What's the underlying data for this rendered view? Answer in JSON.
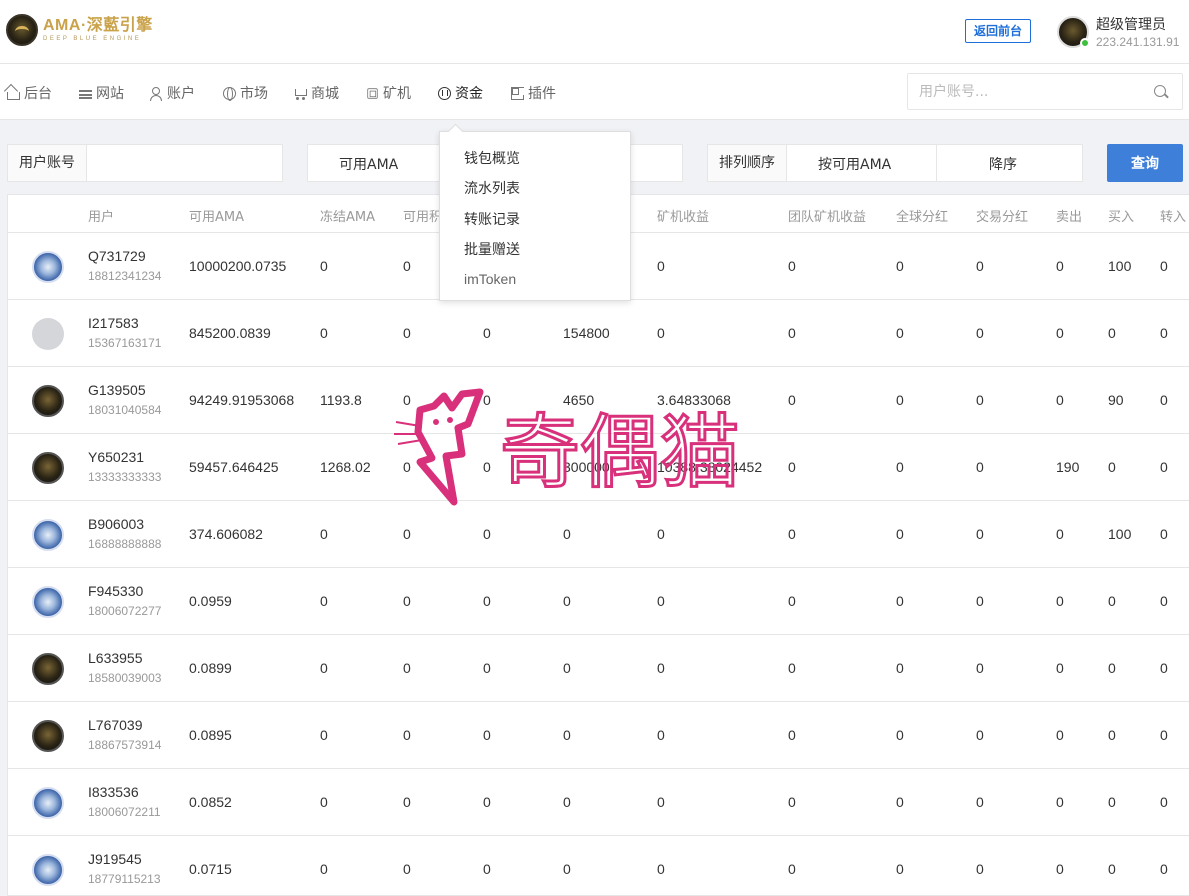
{
  "header": {
    "logo_main": "AMA·深藍引擎",
    "logo_sub": "DEEP BLUE ENGINE",
    "front_button": "返回前台",
    "admin_name": "超级管理员",
    "admin_ip": "223.241.131.91"
  },
  "nav": {
    "items": [
      {
        "label": "后台",
        "icon": "home-icon"
      },
      {
        "label": "网站",
        "icon": "list-icon"
      },
      {
        "label": "账户",
        "icon": "users-icon"
      },
      {
        "label": "市场",
        "icon": "globe-icon"
      },
      {
        "label": "商城",
        "icon": "cart-icon"
      },
      {
        "label": "矿机",
        "icon": "chip-icon"
      },
      {
        "label": "资金",
        "icon": "coin-icon"
      },
      {
        "label": "插件",
        "icon": "grid-icon"
      }
    ],
    "search_placeholder": "用户账号..."
  },
  "dropdown": {
    "items": [
      "钱包概览",
      "流水列表",
      "转账记录",
      "批量赠送",
      "imToken"
    ]
  },
  "filter": {
    "account_label": "用户账号",
    "account_value": "",
    "currency_value": "可用AMA",
    "sort_label": "排列顺序",
    "sort_field": "按可用AMA",
    "sort_dir": "降序",
    "query_button": "查询"
  },
  "table": {
    "headers": [
      "用户",
      "可用AMA",
      "冻结AMA",
      "可用积",
      "",
      "",
      "矿机收益",
      "团队矿机收益",
      "全球分红",
      "交易分红",
      "卖出",
      "买入",
      "转入"
    ],
    "rows": [
      {
        "name": "Q731729",
        "phone": "18812341234",
        "avatar": "blue",
        "cols": [
          "10000200.0735",
          "0",
          "0",
          "",
          "",
          "0",
          "0",
          "0",
          "0",
          "0",
          "100",
          "0"
        ]
      },
      {
        "name": "I217583",
        "phone": "15367163171",
        "avatar": "gray",
        "cols": [
          "845200.0839",
          "0",
          "0",
          "0",
          "154800",
          "0",
          "0",
          "0",
          "0",
          "0",
          "0",
          "0"
        ]
      },
      {
        "name": "G139505",
        "phone": "18031040584",
        "avatar": "dark",
        "cols": [
          "94249.91953068",
          "1193.8",
          "0",
          "0",
          "4650",
          "3.64833068",
          "0",
          "0",
          "0",
          "0",
          "90",
          "0"
        ]
      },
      {
        "name": "Y650231",
        "phone": "13333333333",
        "avatar": "dark",
        "cols": [
          "59457.646425",
          "1268.02",
          "0",
          "0",
          "300000",
          "10388.38024452",
          "0",
          "0",
          "0",
          "190",
          "0",
          "0"
        ]
      },
      {
        "name": "B906003",
        "phone": "16888888888",
        "avatar": "blue",
        "cols": [
          "374.606082",
          "0",
          "0",
          "0",
          "0",
          "0",
          "0",
          "0",
          "0",
          "0",
          "100",
          "0"
        ]
      },
      {
        "name": "F945330",
        "phone": "18006072277",
        "avatar": "blue",
        "cols": [
          "0.0959",
          "0",
          "0",
          "0",
          "0",
          "0",
          "0",
          "0",
          "0",
          "0",
          "0",
          "0"
        ]
      },
      {
        "name": "L633955",
        "phone": "18580039003",
        "avatar": "dark",
        "cols": [
          "0.0899",
          "0",
          "0",
          "0",
          "0",
          "0",
          "0",
          "0",
          "0",
          "0",
          "0",
          "0"
        ]
      },
      {
        "name": "L767039",
        "phone": "18867573914",
        "avatar": "dark",
        "cols": [
          "0.0895",
          "0",
          "0",
          "0",
          "0",
          "0",
          "0",
          "0",
          "0",
          "0",
          "0",
          "0"
        ]
      },
      {
        "name": "I833536",
        "phone": "18006072211",
        "avatar": "blue",
        "cols": [
          "0.0852",
          "0",
          "0",
          "0",
          "0",
          "0",
          "0",
          "0",
          "0",
          "0",
          "0",
          "0"
        ]
      },
      {
        "name": "J919545",
        "phone": "18779115213",
        "avatar": "blue",
        "cols": [
          "0.0715",
          "0",
          "0",
          "0",
          "0",
          "0",
          "0",
          "0",
          "0",
          "0",
          "0",
          "0"
        ]
      }
    ]
  },
  "watermark": {
    "text": "奇偶猫",
    "color": "#d8307a"
  }
}
